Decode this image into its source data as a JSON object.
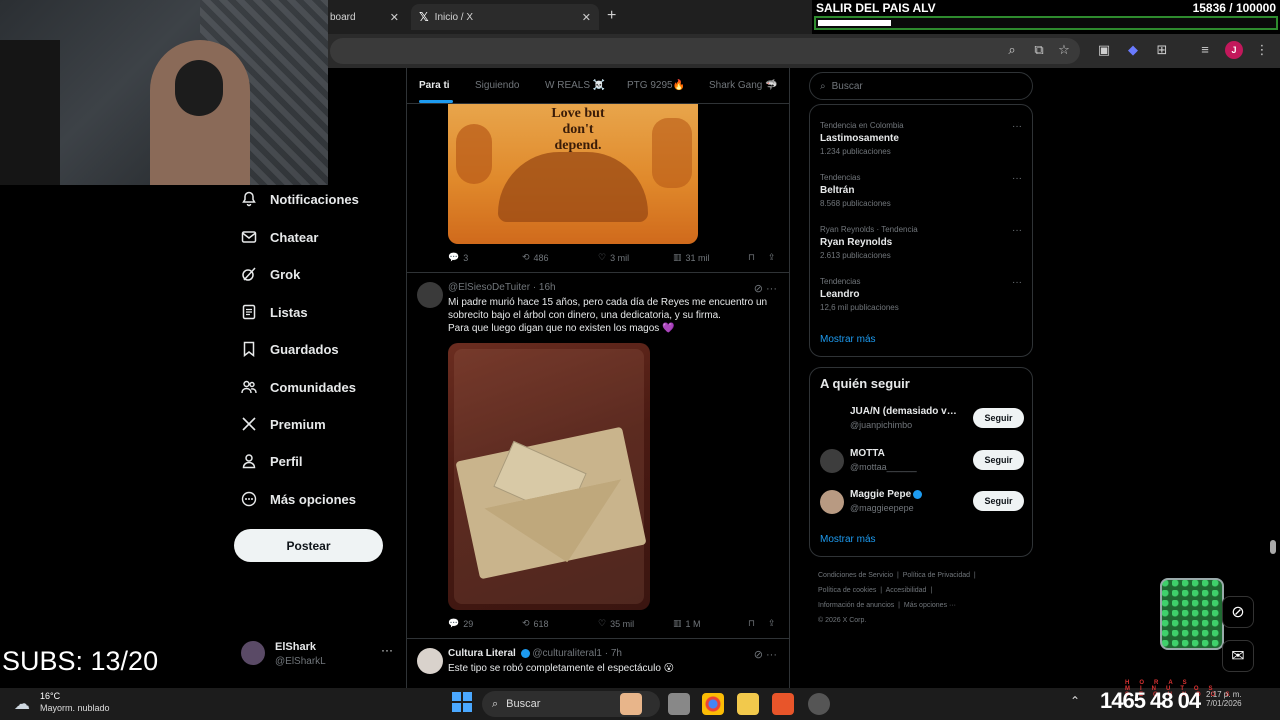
{
  "browser": {
    "tabs": [
      {
        "label": "board",
        "close": "✕"
      },
      {
        "label": "Inicio / X",
        "close": "✕",
        "logo": "𝕏"
      }
    ],
    "new_tab": "+",
    "profile_initial": "J"
  },
  "nav": {
    "items": [
      {
        "label": "Notificaciones",
        "icon": "bell-icon"
      },
      {
        "label": "Chatear",
        "icon": "mail-icon"
      },
      {
        "label": "Grok",
        "icon": "grok-icon"
      },
      {
        "label": "Listas",
        "icon": "list-icon"
      },
      {
        "label": "Guardados",
        "icon": "bookmark-icon"
      },
      {
        "label": "Comunidades",
        "icon": "people-icon"
      },
      {
        "label": "Premium",
        "icon": "x-logo-icon"
      },
      {
        "label": "Perfil",
        "icon": "person-icon"
      },
      {
        "label": "Más opciones",
        "icon": "more-circle-icon"
      }
    ],
    "post_label": "Postear",
    "account": {
      "name": "ElShark",
      "handle": "@ElSharkL",
      "more": "···"
    }
  },
  "feed": {
    "tabs": [
      "Para ti",
      "Siguiendo",
      "W REALS ☠️",
      "PTG 9295🔥",
      "Shark Gang 🦈"
    ],
    "image1_text": "Love but\ndon't\ndepend.",
    "tweet0_stats": {
      "replies": "3",
      "reposts": "486",
      "likes": "3 mil",
      "views": "31 mil"
    },
    "tweet1": {
      "handle": "@ElSiesoDeTuiter",
      "time": "· 16h",
      "text": "Mi padre murió hace 15 años, pero cada día de Reyes me encuentro un sobrecito bajo el árbol con dinero, una dedicatoria, y su firma.\nPara que luego digan que no existen los magos 💜",
      "stats": {
        "replies": "29",
        "reposts": "618",
        "likes": "35 mil",
        "views": "1 M"
      }
    },
    "tweet2": {
      "name": "Cultura Literal",
      "handle": "@culturaliteral1",
      "time": "· 7h",
      "text": "Este tipo se robó completamente el espectáculo 😮"
    }
  },
  "sidebar": {
    "search_placeholder": "Buscar",
    "trends": [
      {
        "meta": "Tendencia en Colombia",
        "topic": "Lastimosamente",
        "count": "1.234 publicaciones"
      },
      {
        "meta": "Tendencias",
        "topic": "Beltrán",
        "count": "8.568 publicaciones"
      },
      {
        "meta": "Ryan Reynolds · Tendencia",
        "topic": "Ryan Reynolds",
        "count": "2.613 publicaciones"
      },
      {
        "meta": "Tendencias",
        "topic": "Leandro",
        "count": "12,6 mil publicaciones"
      }
    ],
    "trends_more": "Mostrar más",
    "who_to_follow": {
      "title": "A quién seguir",
      "people": [
        {
          "name": "JUA/N (demasiado ver...",
          "handle": "@juanpichimbo"
        },
        {
          "name": "MOTTA",
          "handle": "@mottaa______"
        },
        {
          "name": "Maggie Pepe",
          "handle": "@maggieepepe"
        }
      ],
      "follow_label": "Seguir",
      "more": "Mostrar más"
    },
    "footer": [
      "Condiciones de Servicio",
      "Política de Privacidad",
      "Política de cookies",
      "Accesibilidad",
      "Información de anuncios",
      "Más opciones ···",
      "© 2026 X Corp."
    ]
  },
  "overlay": {
    "goal_label": "SALIR DEL PAIS ALV",
    "goal_count": "15836   / 100000",
    "goal_progress": 0.158,
    "subs": "SUBS: 13/20",
    "timer": "1465 48 04",
    "timer_labels": "HORAS MINUTOS SEGUNDOS"
  },
  "taskbar": {
    "temp": "16°C",
    "weather": "Mayorm. nublado",
    "search": "Buscar",
    "time": "2:17 p. m.",
    "date": "7/01/2026",
    "lang": "LAA"
  }
}
